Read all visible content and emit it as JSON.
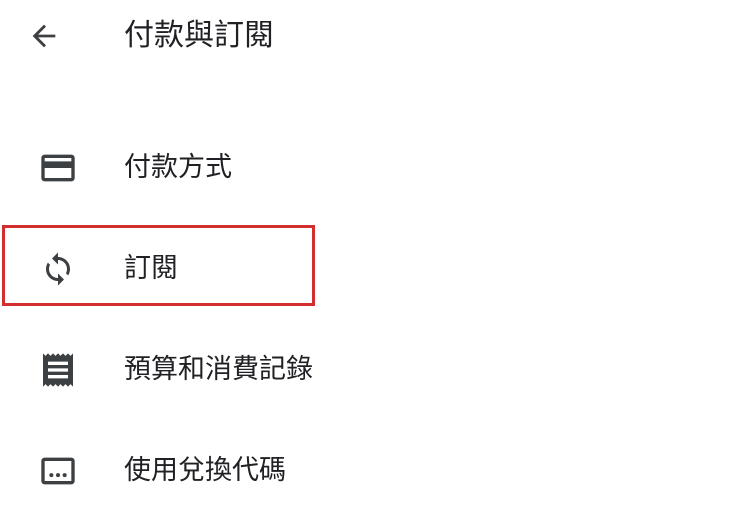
{
  "header": {
    "title": "付款與訂閱",
    "back_icon": "arrow-back-icon"
  },
  "menu": {
    "items": [
      {
        "label": "付款方式",
        "icon": "credit-card-icon"
      },
      {
        "label": "訂閱",
        "icon": "sync-icon"
      },
      {
        "label": "預算和消費記錄",
        "icon": "receipt-icon"
      },
      {
        "label": "使用兌換代碼",
        "icon": "redeem-code-icon"
      }
    ]
  },
  "colors": {
    "text": "#202124",
    "icon": "#3c4043",
    "highlight_border": "#d32f2f",
    "background": "#ffffff"
  }
}
